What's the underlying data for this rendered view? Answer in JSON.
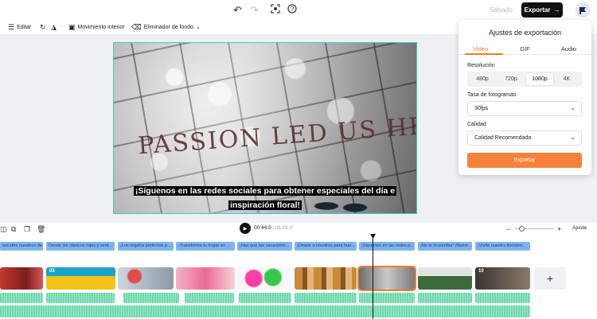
{
  "header": {
    "saved_label": "Salvado",
    "export_label": "Exportar",
    "icons": [
      "undo-icon",
      "redo-icon",
      "screen-capture-icon",
      "help-icon",
      "avatar-icon"
    ]
  },
  "toolbar": {
    "edit_label": "Editar",
    "motion_label": "Movimiento interior",
    "bg_remover_label": "Eliminador de fondo"
  },
  "video": {
    "wall_text": "PASSION LED US HERE",
    "subtitle": "¡Síguenos en las redes sociales para obtener especiales del día e inspiración floral!"
  },
  "export_panel": {
    "title": "Ajustes de exportación",
    "tabs": [
      "Video",
      "GIF",
      "Audio"
    ],
    "active_tab": "Video",
    "resolution_label": "Resolución",
    "resolutions": [
      "480p",
      "720p",
      "1080p",
      "4K"
    ],
    "selected_resolution": "1080p",
    "framerate_label": "Tasa de fotogramas",
    "framerate_value": "30fps",
    "quality_label": "Calidad",
    "quality_value": "Calidad Recomendada",
    "export_button": "Exportar",
    "accent_color": "#f07f2d"
  },
  "player": {
    "current_time": "00:44.9",
    "duration": "/ 01:01.0",
    "fit_label": "Ajuste"
  },
  "timeline": {
    "captions": [
      "escubre nuestros de...",
      "Desde los clásicos rojos y verd...",
      "¡Los regalos perfectos p...",
      "¡Transforma tu hogar en ...",
      "¡Haz que tus vacacione...",
      "¡Únase a nosotros para hue...",
      "¡Síguenos en las redes p...",
      "¡No te lo pierdas! ¡Nuest...",
      "¡Visite nuestra floristeri..."
    ],
    "clip_numbers": [
      "03",
      "10"
    ]
  }
}
